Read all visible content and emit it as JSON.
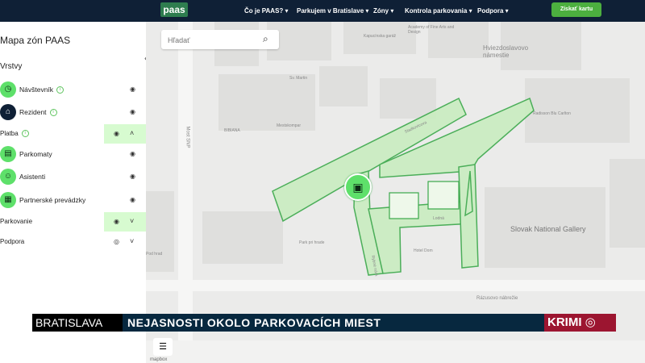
{
  "header": {
    "logo": "paas",
    "nav": [
      "Čo je PAAS?",
      "Parkujem v Bratislave",
      "Zóny",
      "Kontrola parkovania",
      "Podpora"
    ],
    "cta": "Získať kartu"
  },
  "sidebar": {
    "title": "Mapa zón PAAS",
    "section": "Vrstvy",
    "layers": [
      {
        "label": "Návštevník",
        "icon": "clock-icon",
        "info": true
      },
      {
        "label": "Rezident",
        "icon": "house-icon",
        "info": true
      }
    ],
    "platba": {
      "label": "Platba",
      "info": true
    },
    "payment_items": [
      {
        "label": "Parkomaty",
        "icon": "parking-meter-icon"
      },
      {
        "label": "Asistenti",
        "icon": "assistant-icon"
      },
      {
        "label": "Partnerské prevádzky",
        "icon": "shop-icon"
      }
    ],
    "groups": [
      {
        "label": "Parkovanie"
      },
      {
        "label": "Podpora"
      }
    ]
  },
  "search": {
    "placeholder": "Hľadať"
  },
  "map": {
    "labels": [
      "Kapucínska garáž",
      "Academy of Fine Arts and Design",
      "Hviezdoslavovo námestie",
      "Sv. Martin",
      "Radisson Blu Carlton",
      "BIBIANA",
      "Mestskompar",
      "Slovak National Gallery",
      "Pod hrad",
      "Rázusovo nábrežie",
      "Most SNP",
      "Sladkovicova",
      "Lodná",
      "Hotel Dom",
      "Park pri hrade",
      "Rybné nám."
    ],
    "zone_color": "#3aa84a",
    "zone_fill": "#c9edc0"
  },
  "ticker": {
    "city": "BRATISLAVA",
    "headline": "NEJASNOSTI OKOLO PARKOVACÍCH MIEST",
    "channel": "KRIMI"
  },
  "mapbox": "mapbox"
}
